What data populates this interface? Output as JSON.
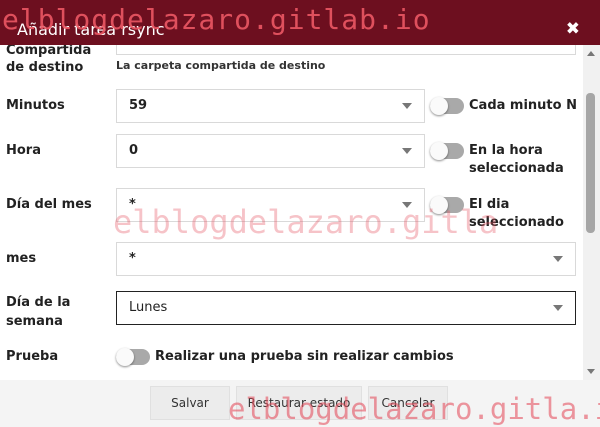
{
  "watermark": "elblogdelazaro.gitlab.io",
  "watermark_mid": "elblogdelazaro.gitla",
  "watermark_bottom": "elblogdelazaro.gitla.io",
  "dialog": {
    "title": "Añadir tarea rsync",
    "close_glyph": "✖"
  },
  "form": {
    "dest_share_label": "Compartida de destino",
    "dest_share_hint": "La carpeta compartida de destino",
    "minutes": {
      "label": "Minutos",
      "value": "59",
      "toggle_label": "Cada minuto N",
      "toggle_on": false
    },
    "hour": {
      "label": "Hora",
      "value": "0",
      "toggle_label_1": "En la hora",
      "toggle_label_2": "seleccionada",
      "toggle_on": false
    },
    "day_of_month": {
      "label": "Día del mes",
      "value": "*",
      "toggle_label_1": "El dia",
      "toggle_label_2": "seleccionado",
      "toggle_on": false
    },
    "month": {
      "label": "mes",
      "value": "*"
    },
    "day_of_week": {
      "label_1": "Día de la",
      "label_2": "semana",
      "value": "Lunes"
    },
    "test": {
      "label": "Prueba",
      "toggle_label": "Realizar una prueba sin realizar cambios",
      "toggle_on": false
    }
  },
  "footer": {
    "save": "Salvar",
    "reset": "Restaurar estado",
    "cancel": "Cancelar"
  },
  "colors": {
    "titlebar": "#6d0f1f",
    "watermark": "#e55260"
  }
}
